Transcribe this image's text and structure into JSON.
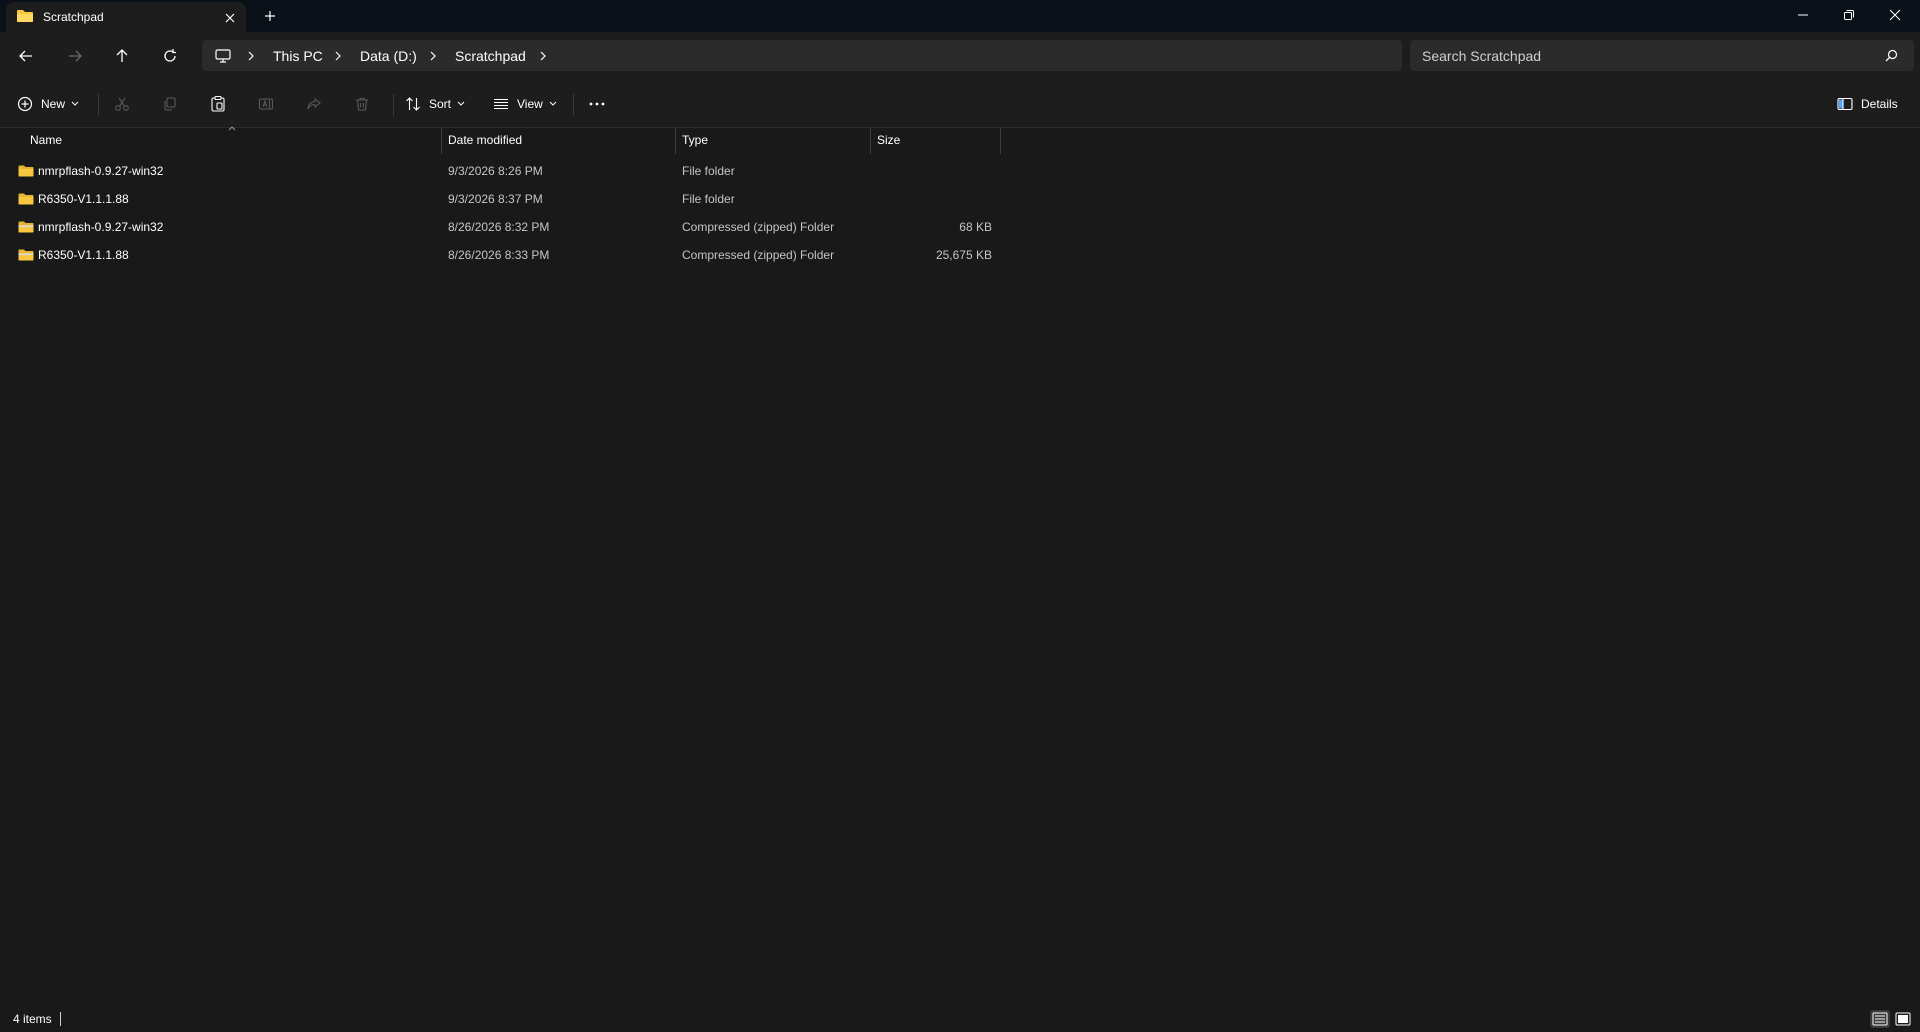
{
  "window": {
    "tab_title": "Scratchpad",
    "icons": {
      "folder": "folder-icon",
      "close": "close-icon",
      "new_tab": "plus-icon",
      "minimize": "minimize-icon",
      "restore": "restore-icon",
      "close_window": "close-icon"
    }
  },
  "nav": {
    "breadcrumbs": [
      "This PC",
      "Data (D:)",
      "Scratchpad"
    ],
    "search_placeholder": "Search Scratchpad",
    "icons": [
      "back-icon",
      "forward-icon",
      "up-icon",
      "refresh-icon",
      "computer-icon",
      "search-icon"
    ]
  },
  "commands": {
    "new_label": "New",
    "sort_label": "Sort",
    "view_label": "View",
    "details_label": "Details"
  },
  "columns": {
    "name": "Name",
    "date": "Date modified",
    "type": "Type",
    "size": "Size"
  },
  "files": [
    {
      "name": "nmrpflash-0.9.27-win32",
      "date": "9/3/2026 8:26 PM",
      "type": "File folder",
      "size": ""
    },
    {
      "name": "R6350-V1.1.1.88",
      "date": "9/3/2026 8:37 PM",
      "type": "File folder",
      "size": ""
    },
    {
      "name": "nmrpflash-0.9.27-win32",
      "date": "8/26/2026 8:32 PM",
      "type": "Compressed (zipped) Folder",
      "size": "68 KB"
    },
    {
      "name": "R6350-V1.1.1.88",
      "date": "8/26/2026 8:33 PM",
      "type": "Compressed (zipped) Folder",
      "size": "25,675 KB"
    }
  ],
  "status": {
    "count": "4 items"
  },
  "colors": {
    "folder": "#f8c73f",
    "zip_band": "#d9d9d9",
    "background": "#191919",
    "toolbar": "#1d1d1d",
    "titlebar": "#0a1119"
  }
}
